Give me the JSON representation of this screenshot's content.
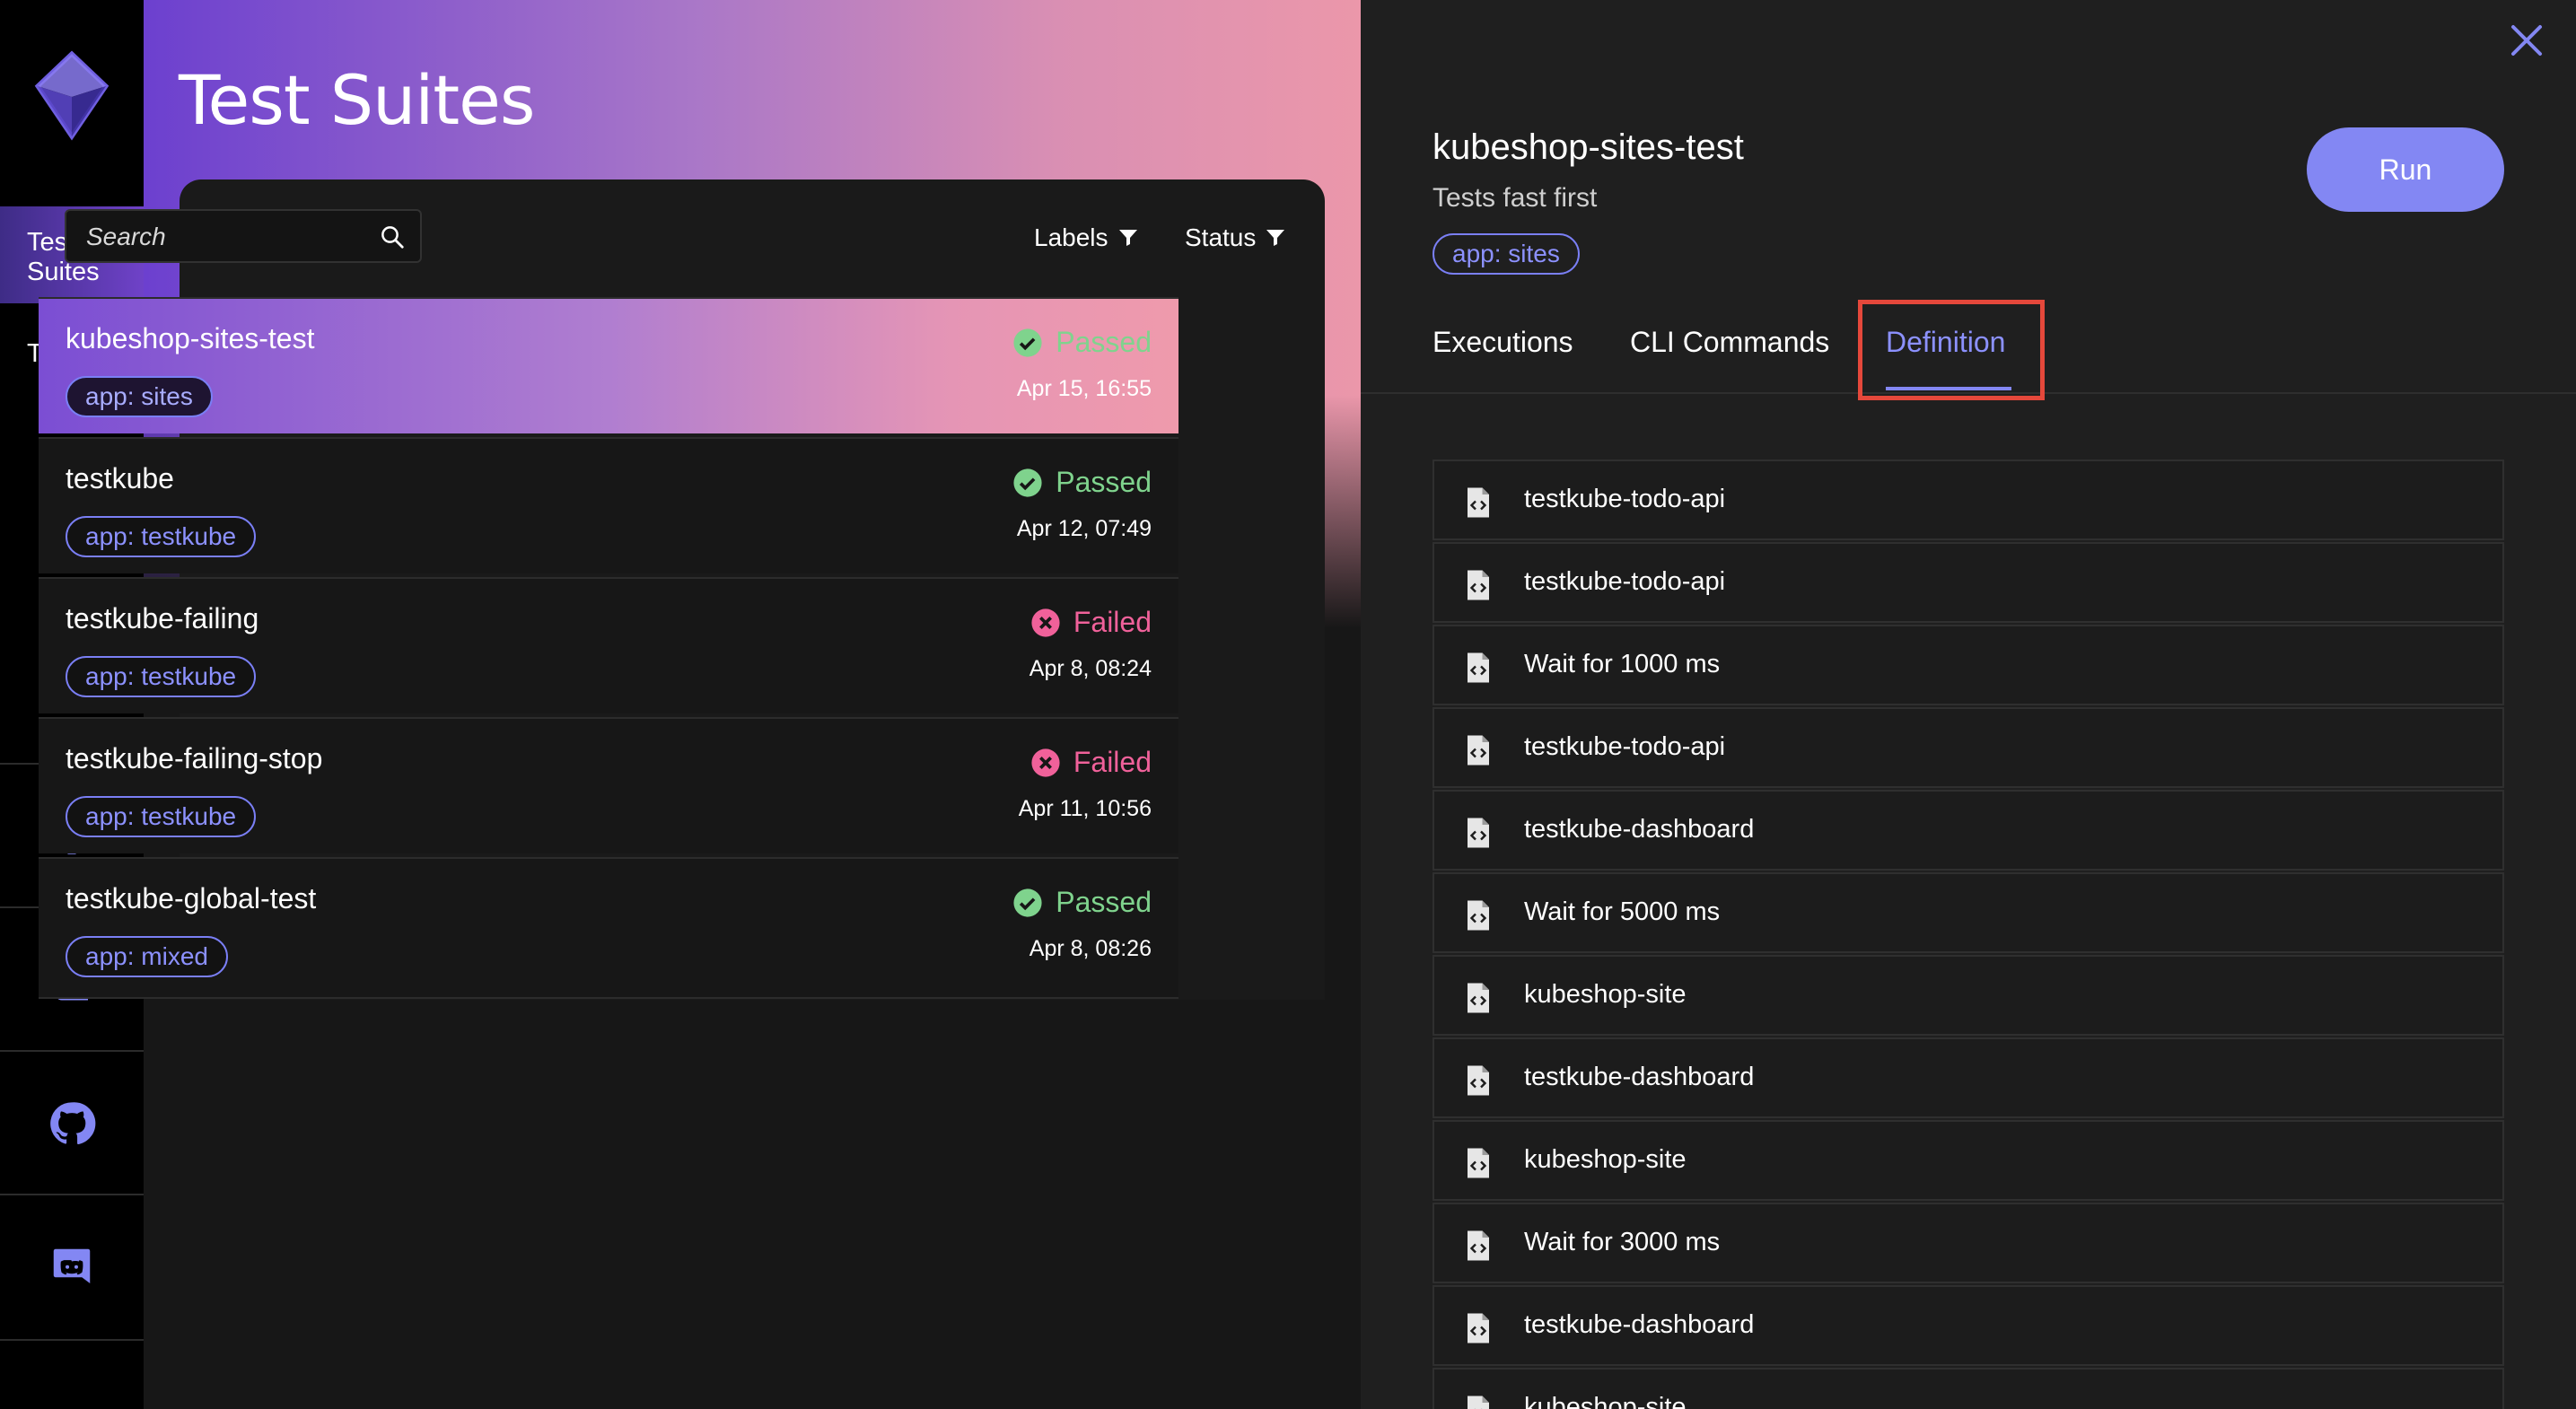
{
  "app": {
    "title": "Test Suites"
  },
  "nav": {
    "items": [
      {
        "label": "Test\nSuites",
        "active": true
      },
      {
        "label": "Tests",
        "active": false
      }
    ],
    "bottom_icons": [
      "gear-icon",
      "book-icon",
      "github-icon",
      "discord-icon"
    ]
  },
  "list": {
    "search_placeholder": "Search",
    "filters": [
      {
        "label": "Labels"
      },
      {
        "label": "Status"
      }
    ],
    "suites": [
      {
        "name": "kubeshop-sites-test",
        "tag": "app: sites",
        "status": "Passed",
        "date": "Apr 15, 16:55",
        "active": true
      },
      {
        "name": "testkube",
        "tag": "app: testkube",
        "status": "Passed",
        "date": "Apr 12, 07:49",
        "active": false
      },
      {
        "name": "testkube-failing",
        "tag": "app: testkube",
        "status": "Failed",
        "date": "Apr 8, 08:24",
        "active": false
      },
      {
        "name": "testkube-failing-stop",
        "tag": "app: testkube",
        "status": "Failed",
        "date": "Apr 11, 10:56",
        "active": false
      },
      {
        "name": "testkube-global-test",
        "tag": "app: mixed",
        "status": "Passed",
        "date": "Apr 8, 08:26",
        "active": false
      }
    ]
  },
  "detail": {
    "title": "kubeshop-sites-test",
    "description": "Tests fast first",
    "tag": "app: sites",
    "run_label": "Run",
    "tabs": [
      {
        "label": "Executions",
        "active": false
      },
      {
        "label": "CLI Commands",
        "active": false
      },
      {
        "label": "Definition",
        "active": true
      }
    ],
    "steps": [
      "testkube-todo-api",
      "testkube-todo-api",
      "Wait for 1000 ms",
      "testkube-todo-api",
      "testkube-dashboard",
      "Wait for 5000 ms",
      "kubeshop-site",
      "testkube-dashboard",
      "kubeshop-site",
      "Wait for 3000 ms",
      "testkube-dashboard",
      "kubeshop-site"
    ]
  },
  "colors": {
    "accent": "#8387f3",
    "passed": "#7fd38d",
    "failed": "#f0619a",
    "highlight": "#e5483b"
  }
}
